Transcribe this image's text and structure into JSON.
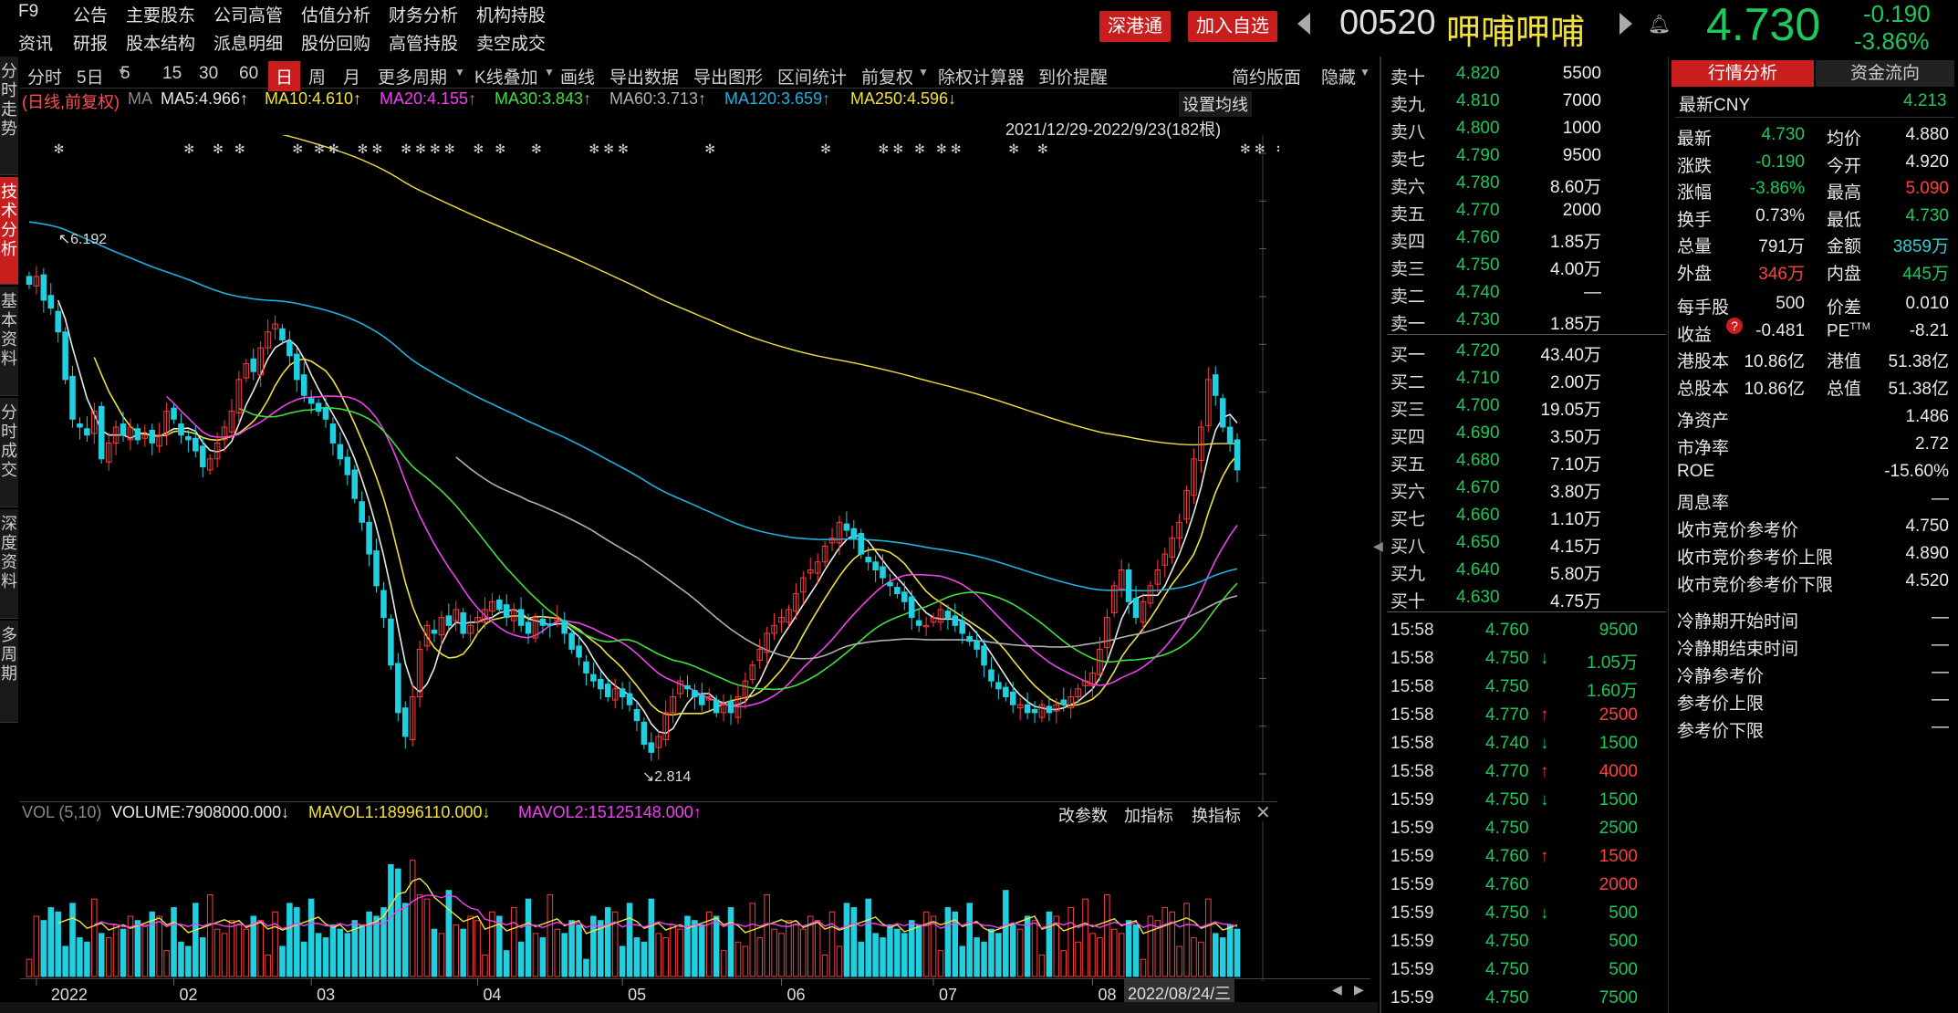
{
  "topmenu": {
    "row1": [
      "F9",
      "公告",
      "主要股东",
      "公司高管",
      "估值分析",
      "财务分析",
      "机构持股"
    ],
    "row2": [
      "资讯",
      "研报",
      "股本结构",
      "派息明细",
      "股份回购",
      "高管持股",
      "卖空成交"
    ]
  },
  "header": {
    "sht_label": "深港通",
    "watch_label": "加入自选",
    "code": "00520",
    "name": "呷哺呷哺",
    "price": "4.730",
    "change": "-0.190",
    "change_pct": "-3.86%"
  },
  "toolbar": {
    "items": [
      "分时",
      "5日",
      "5",
      "15",
      "30",
      "60",
      "日",
      "周",
      "月",
      "更多周期",
      "K线叠加",
      "画线",
      "导出数据",
      "导出图形",
      "区间统计",
      "前复权",
      "除权计算器",
      "到价提醒"
    ],
    "simple": "简约版面",
    "hide": "隐藏"
  },
  "sidetabs": [
    "分时走势",
    "技术分析",
    "基本资料",
    "分时成交",
    "深度资料",
    "多周期"
  ],
  "chart_data": {
    "type": "candlestick",
    "mode": "(日线,前复权)",
    "ma_prefix": "MA",
    "ma": [
      {
        "name": "MA5:4.966↑",
        "color": "#e8e8e8"
      },
      {
        "name": "MA10:4.610↑",
        "color": "#f0e040"
      },
      {
        "name": "MA20:4.155↑",
        "color": "#f040f0"
      },
      {
        "name": "MA30:3.843↑",
        "color": "#40e040"
      },
      {
        "name": "MA60:3.713↑",
        "color": "#b0b0b0"
      },
      {
        "name": "MA120:3.659↑",
        "color": "#20b0e0"
      },
      {
        "name": "MA250:4.596↓",
        "color": "#f0e040"
      }
    ],
    "setting": "设置均线",
    "range_label": "2021/12/29-2022/9/23(182根)",
    "y_ticks": [
      "6.726",
      "6.425",
      "6.124",
      "5.823",
      "5.522",
      "5.221",
      "4.920",
      "4.619",
      "4.319",
      "4.018",
      "3.717",
      "3.416",
      "3.115",
      "2.814"
    ],
    "ylim": [
      2.814,
      6.726
    ],
    "x_ticks": [
      "2022",
      "02",
      "03",
      "04",
      "05",
      "06",
      "07",
      "08"
    ],
    "high_label": "6.192",
    "low_label": "2.814",
    "close": [
      5.9,
      5.95,
      5.8,
      5.75,
      5.6,
      5.3,
      5.05,
      5.0,
      4.95,
      5.1,
      4.8,
      4.9,
      5.0,
      4.95,
      5.0,
      4.92,
      4.95,
      4.9,
      4.95,
      5.1,
      5.05,
      4.95,
      4.92,
      4.85,
      4.75,
      4.8,
      4.9,
      5.0,
      5.1,
      5.3,
      5.4,
      5.35,
      5.5,
      5.6,
      5.65,
      5.55,
      5.45,
      5.3,
      5.2,
      5.15,
      5.1,
      5.05,
      4.9,
      4.8,
      4.7,
      4.55,
      4.4,
      4.2,
      4.0,
      3.8,
      3.5,
      3.2,
      3.05,
      3.3,
      3.6,
      3.75,
      3.7,
      3.8,
      3.75,
      3.85,
      3.7,
      3.75,
      3.8,
      3.85,
      3.9,
      3.85,
      3.8,
      3.85,
      3.75,
      3.7,
      3.8,
      3.75,
      3.75,
      3.8,
      3.7,
      3.6,
      3.55,
      3.45,
      3.4,
      3.35,
      3.3,
      3.35,
      3.3,
      3.25,
      3.15,
      3.0,
      2.95,
      3.05,
      3.2,
      3.3,
      3.4,
      3.35,
      3.3,
      3.25,
      3.3,
      3.2,
      3.25,
      3.2,
      3.3,
      3.4,
      3.5,
      3.6,
      3.7,
      3.75,
      3.8,
      3.85,
      3.95,
      4.05,
      4.1,
      4.15,
      4.25,
      4.3,
      4.4,
      4.35,
      4.3,
      4.2,
      4.15,
      4.1,
      4.05,
      4.0,
      3.95,
      3.9,
      3.8,
      3.75,
      3.75,
      3.8,
      3.85,
      3.8,
      3.75,
      3.7,
      3.65,
      3.6,
      3.5,
      3.4,
      3.35,
      3.3,
      3.25,
      3.25,
      3.2,
      3.2,
      3.25,
      3.2,
      3.25,
      3.25,
      3.3,
      3.35,
      3.4,
      3.45,
      3.6,
      3.8,
      4.0,
      4.1,
      3.9,
      3.8,
      3.9,
      4.0,
      4.1,
      4.2,
      4.3,
      4.4,
      4.6,
      4.8,
      5.0,
      5.3,
      5.2,
      5.0,
      4.9,
      4.73
    ],
    "vol_label": "VOL (5,10)",
    "vol_values": [
      {
        "name": "VOLUME:7908000.000↓",
        "color": "#e8e8e8"
      },
      {
        "name": "MAVOL1:18996110.000↓",
        "color": "#f0e040"
      },
      {
        "name": "MAVOL2:15125148.000↑",
        "color": "#f040f0"
      }
    ],
    "vol_tools": [
      "改参数",
      "加指标",
      "换指标"
    ],
    "vol_ticks": [
      "3485万",
      "2323万",
      "1162万",
      "0.00"
    ],
    "date_label": "2022/08/24/三"
  },
  "orderbook": {
    "asks": [
      [
        "卖十",
        "4.820",
        "5500"
      ],
      [
        "卖九",
        "4.810",
        "7000"
      ],
      [
        "卖八",
        "4.800",
        "1000"
      ],
      [
        "卖七",
        "4.790",
        "9500"
      ],
      [
        "卖六",
        "4.780",
        "8.60万"
      ],
      [
        "卖五",
        "4.770",
        "2000"
      ],
      [
        "卖四",
        "4.760",
        "1.85万"
      ],
      [
        "卖三",
        "4.750",
        "4.00万"
      ],
      [
        "卖二",
        "4.740",
        "—"
      ],
      [
        "卖一",
        "4.730",
        "1.85万"
      ]
    ],
    "bids": [
      [
        "买一",
        "4.720",
        "43.40万"
      ],
      [
        "买二",
        "4.710",
        "2.00万"
      ],
      [
        "买三",
        "4.700",
        "19.05万"
      ],
      [
        "买四",
        "4.690",
        "3.50万"
      ],
      [
        "买五",
        "4.680",
        "7.10万"
      ],
      [
        "买六",
        "4.670",
        "3.80万"
      ],
      [
        "买七",
        "4.660",
        "1.10万"
      ],
      [
        "买八",
        "4.650",
        "4.15万"
      ],
      [
        "买九",
        "4.640",
        "5.80万"
      ],
      [
        "买十",
        "4.630",
        "4.75万"
      ]
    ]
  },
  "ticks": [
    [
      "15:58",
      "4.760",
      "",
      "9500",
      "g"
    ],
    [
      "15:58",
      "4.750",
      "↓",
      "1.05万",
      "g"
    ],
    [
      "15:58",
      "4.750",
      "",
      "1.60万",
      "g"
    ],
    [
      "15:58",
      "4.770",
      "↑",
      "2500",
      "r"
    ],
    [
      "15:58",
      "4.740",
      "↓",
      "1500",
      "g"
    ],
    [
      "15:58",
      "4.770",
      "↑",
      "4000",
      "r"
    ],
    [
      "15:59",
      "4.750",
      "↓",
      "1500",
      "g"
    ],
    [
      "15:59",
      "4.750",
      "",
      "2500",
      "g"
    ],
    [
      "15:59",
      "4.760",
      "↑",
      "1500",
      "r"
    ],
    [
      "15:59",
      "4.760",
      "",
      "2000",
      "r"
    ],
    [
      "15:59",
      "4.750",
      "↓",
      "500",
      "g"
    ],
    [
      "15:59",
      "4.750",
      "",
      "500",
      "g"
    ],
    [
      "15:59",
      "4.750",
      "",
      "500",
      "g"
    ],
    [
      "15:59",
      "4.750",
      "",
      "7500",
      "g"
    ]
  ],
  "quote": {
    "tab_active": "行情分析",
    "tab2": "资金流向",
    "latest_cny_label": "最新CNY",
    "latest_cny": "4.213",
    "rows": [
      [
        "最新",
        "4.730",
        "green",
        "均价",
        "4.880",
        "wht"
      ],
      [
        "涨跌",
        "-0.190",
        "green",
        "今开",
        "4.920",
        "wht"
      ],
      [
        "涨幅",
        "-3.86%",
        "green",
        "最高",
        "5.090",
        "red"
      ],
      [
        "换手",
        "0.73%",
        "wht",
        "最低",
        "4.730",
        "green"
      ],
      [
        "总量",
        "791万",
        "wht",
        "金额",
        "3859万",
        "cyan"
      ],
      [
        "外盘",
        "346万",
        "red",
        "内盘",
        "445万",
        "green"
      ],
      [
        "每手股",
        "500",
        "wht",
        "价差",
        "0.010",
        "wht"
      ],
      [
        "收益",
        "-0.481",
        "wht",
        "PE",
        "-8.21",
        "wht"
      ],
      [
        "港股本",
        "10.86亿",
        "wht",
        "港值",
        "51.38亿",
        "wht"
      ],
      [
        "总股本",
        "10.86亿",
        "wht",
        "总值",
        "51.38亿",
        "wht"
      ]
    ],
    "pe_sup": "TTM",
    "rows2": [
      [
        "净资产",
        "1.486"
      ],
      [
        "市净率",
        "2.72"
      ],
      [
        "ROE",
        "-15.60%"
      ],
      [
        "周息率",
        "—"
      ],
      [
        "收市竞价参考价",
        "4.750"
      ],
      [
        "收市竞价参考价上限",
        "4.890"
      ],
      [
        "收市竞价参考价下限",
        "4.520"
      ]
    ],
    "rows3": [
      [
        "冷静期开始时间",
        "—"
      ],
      [
        "冷静期结束时间",
        "—"
      ],
      [
        "冷静参考价",
        "—"
      ],
      [
        "参考价上限",
        "—"
      ],
      [
        "参考价下限",
        "—"
      ]
    ]
  },
  "colors": {
    "up": "#ff3c3c",
    "down": "#20d0e0",
    "accent": "#c81e1e"
  }
}
